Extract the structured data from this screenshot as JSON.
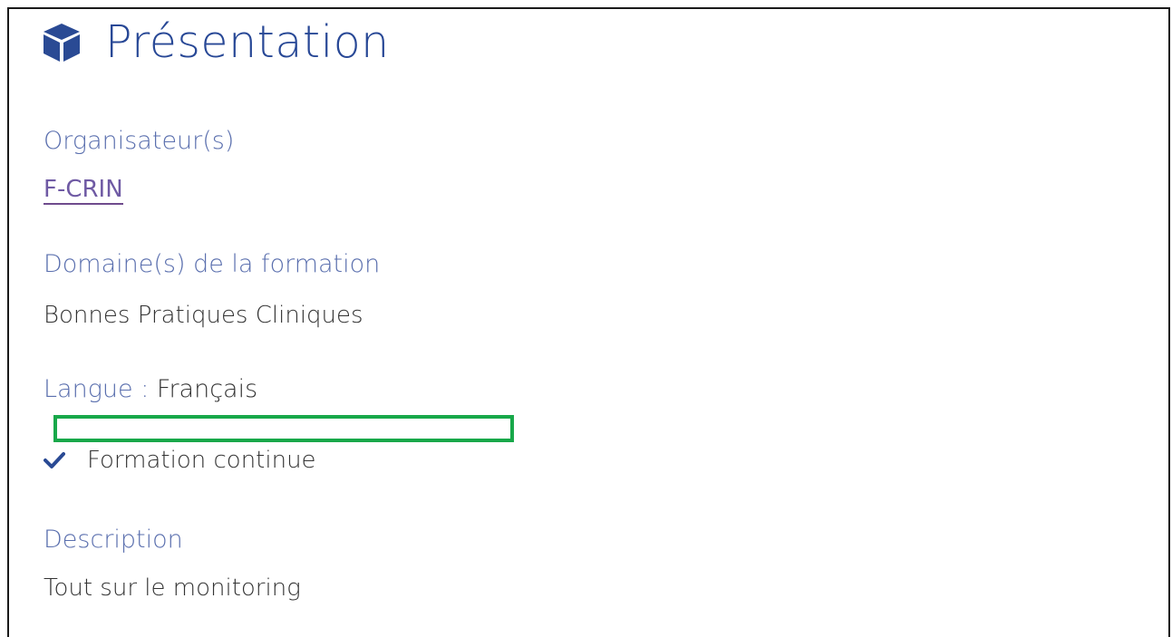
{
  "header": {
    "icon": "cube-icon",
    "title": "Présentation"
  },
  "organisateur": {
    "label": "Organisateur(s)",
    "link_text": "F-CRIN"
  },
  "domaine": {
    "label": "Domaine(s) de la formation",
    "value": "Bonnes Pratiques Cliniques"
  },
  "langue": {
    "label": "Langue : ",
    "value": "Français"
  },
  "formation_continue": {
    "icon": "checkmark-icon",
    "label": "Formation continue"
  },
  "description": {
    "label": "Description",
    "value": "Tout sur le monitoring"
  },
  "colors": {
    "accent": "#284896",
    "label": "#5a6fae",
    "text": "#333333",
    "link": "#6f5aa4",
    "highlight": "#18a84a"
  }
}
